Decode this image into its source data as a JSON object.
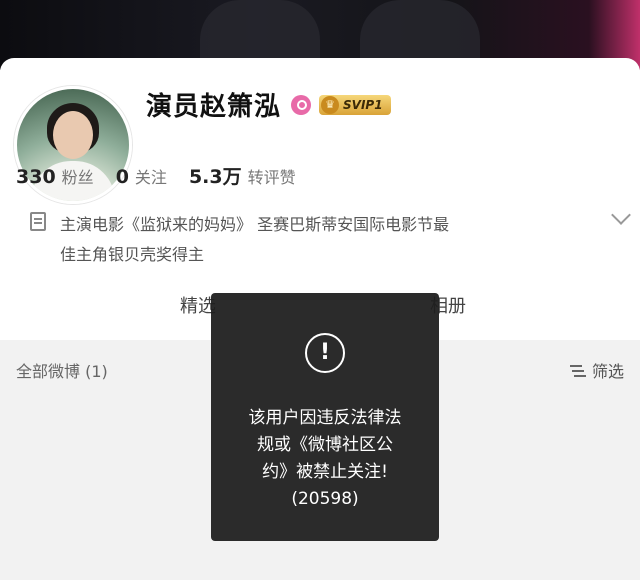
{
  "profile": {
    "name": "演员赵箫泓",
    "svip_label": "SVIP1",
    "stats": [
      {
        "value": "330",
        "label": "粉丝"
      },
      {
        "value": "0",
        "label": "关注"
      },
      {
        "value": "5.3万",
        "label": "转评赞"
      }
    ],
    "bio_line1": "主演电影《监狱来的妈妈》 圣赛巴斯蒂安国际电影节最",
    "bio_line2": "佳主角银贝壳奖得主"
  },
  "tabs": {
    "left_partial": "精选",
    "right_partial": "相册"
  },
  "filter_bar": {
    "all_posts": "全部微博 (1)",
    "filter_label": "筛选"
  },
  "toast": {
    "icon": "!",
    "line1": "该用户因违反法律法",
    "line2": "规或《微博社区公",
    "line3": "约》被禁止关注!",
    "line4": "(20598)"
  },
  "colors": {
    "card_bg": "#ffffff",
    "page_bg": "#f2f2f2",
    "toast_bg": "#1e1e1e",
    "svip_gold": "#d9a338",
    "verified_pink": "#e86aa8"
  }
}
